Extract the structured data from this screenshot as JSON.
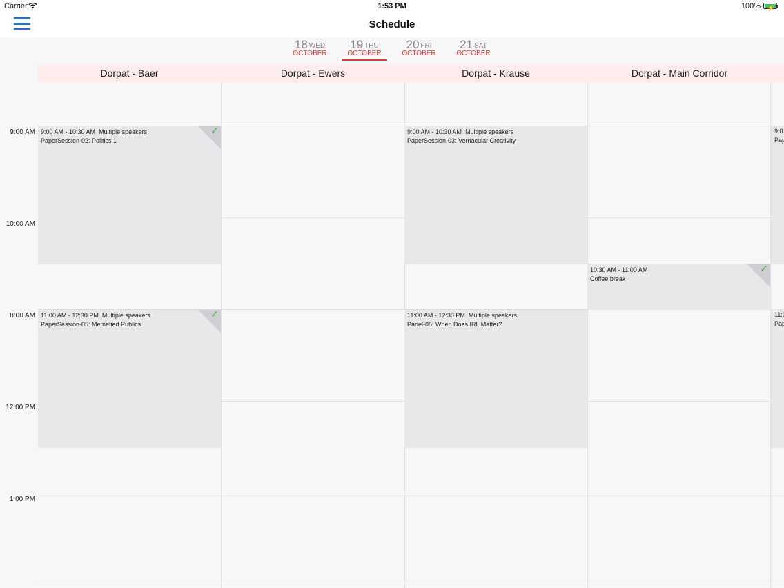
{
  "status_bar": {
    "carrier": "Carrier",
    "time": "1:53 PM",
    "battery": "100%",
    "battery_level": 1.0
  },
  "nav": {
    "title": "Schedule"
  },
  "days": [
    {
      "num": "18",
      "dow": "WED",
      "month": "OCTOBER"
    },
    {
      "num": "19",
      "dow": "THU",
      "month": "OCTOBER",
      "selected": true
    },
    {
      "num": "20",
      "dow": "FRI",
      "month": "OCTOBER"
    },
    {
      "num": "21",
      "dow": "SAT",
      "month": "OCTOBER"
    }
  ],
  "rooms": [
    "Dorpat - Baer",
    "Dorpat - Ewers",
    "Dorpat - Krause",
    "Dorpat - Main Corridor"
  ],
  "time_labels": [
    "9:00 AM",
    "10:00 AM",
    "8:00 AM",
    "12:00 PM",
    "1:00 PM"
  ],
  "events": [
    {
      "time": "9:00 AM - 10:30 AM",
      "speakers": "Multiple speakers",
      "title": "PaperSession-02: Politics 1",
      "checked": true
    },
    {
      "time": "11:00 AM - 12:30 PM",
      "speakers": "Multiple speakers",
      "title": "PaperSession-05: Memefied Publics",
      "checked": true
    },
    {
      "time": "9:00 AM - 10:30 AM",
      "speakers": "Multiple speakers",
      "title": "PaperSession-03: Vernacular Creativity",
      "checked": false
    },
    {
      "time": "11:00 AM - 12:30 PM",
      "speakers": "Multiple speakers",
      "title": "Panel-05: When Does IRL Matter?",
      "checked": false
    },
    {
      "time": "10:30 AM - 11:00 AM",
      "speakers": "",
      "title": "Coffee break",
      "checked": true
    }
  ],
  "peek": [
    {
      "time": "9:0",
      "title": "Pap"
    },
    {
      "time": "11:0",
      "title": "Pap"
    }
  ],
  "colors": {
    "accent": "#e8333b",
    "menu": "#2a6fd0",
    "check": "#4caf50",
    "room_header_bg": "#fdeeed"
  }
}
